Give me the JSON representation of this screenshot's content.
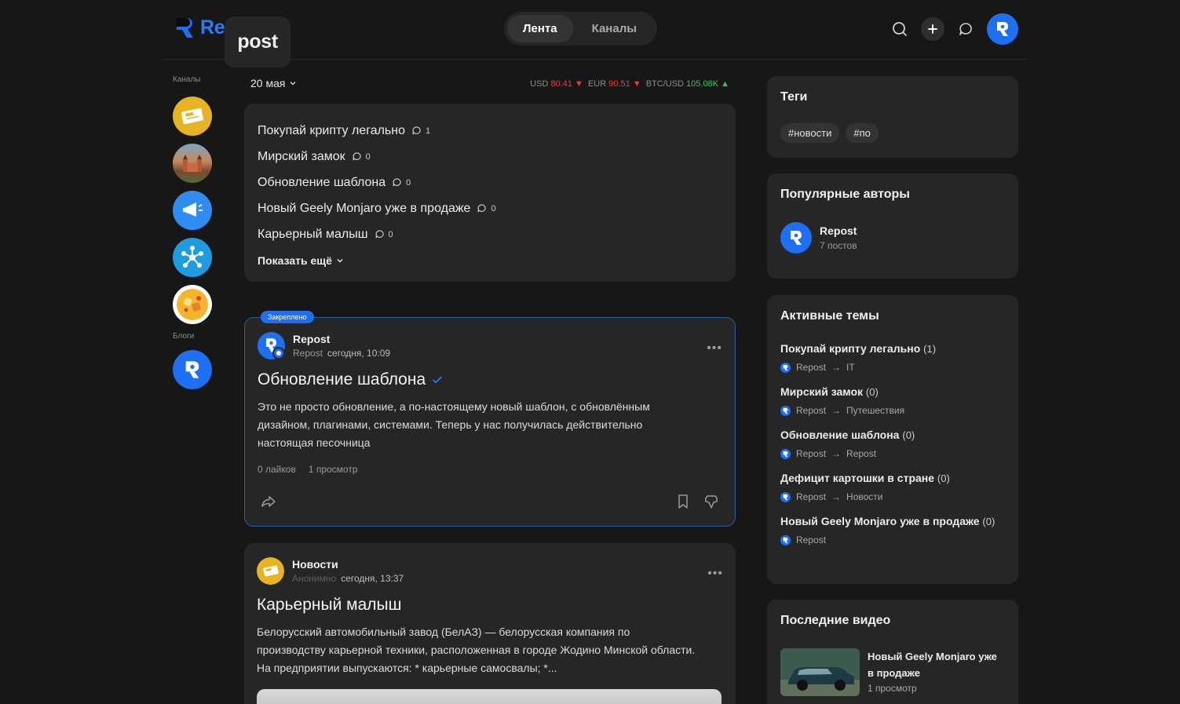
{
  "app": {
    "logo_re": "Re",
    "logo_post": "post"
  },
  "nav": {
    "tabs": [
      {
        "label": "Лента",
        "active": true
      },
      {
        "label": "Каналы",
        "active": false
      }
    ]
  },
  "header_icons": [
    "search-icon",
    "plus-icon",
    "chat-icon",
    "user-avatar"
  ],
  "leftrail": {
    "channels_label": "Каналы",
    "blogs_label": "Блоги",
    "channels": [
      {
        "name": "news-channel",
        "color": "#e6b422"
      },
      {
        "name": "castle-channel",
        "color": "#8b6a4f"
      },
      {
        "name": "megaphone-channel",
        "color": "#2f8cf0"
      },
      {
        "name": "network-channel",
        "color": "#1f9be0"
      },
      {
        "name": "food-channel",
        "color": "#f3b52b"
      }
    ],
    "blogs": [
      {
        "name": "repost-blog",
        "color": "#1f6ff2"
      }
    ]
  },
  "feed": {
    "date": "20 мая",
    "rates": [
      {
        "label": "USD",
        "value": "80.41",
        "dir": "down"
      },
      {
        "label": "EUR",
        "value": "90.51",
        "dir": "down"
      },
      {
        "label": "BTC/USD",
        "value": "105.08K",
        "dir": "up"
      }
    ],
    "topics": [
      {
        "title": "Покупай крипту легально",
        "comments": "1"
      },
      {
        "title": "Мирский замок",
        "comments": "0"
      },
      {
        "title": "Обновление шаблона",
        "comments": "0"
      },
      {
        "title": "Новый Geely Monjaro уже в продаже",
        "comments": "0"
      },
      {
        "title": "Карьерный малыш",
        "comments": "0"
      }
    ],
    "show_more": "Показать ещё"
  },
  "posts": [
    {
      "pinned_label": "Закреплено",
      "author": "Repost",
      "source": "Repost",
      "time": "сегодня, 10:09",
      "title": "Обновление шаблона",
      "body": "Это не просто обновление, а по-настоящему новый шаблон, с обновлённым дизайном, плагинами, системами. Теперь у нас получилась действительно настоящая песочница",
      "likes": "0 лайков",
      "views": "1 просмотр"
    },
    {
      "author": "Новости",
      "source": "Анонимно",
      "time": "сегодня, 13:37",
      "title": "Карьерный малыш",
      "body": "Белорусский автомобильный завод (БелАЗ) — белорусская компания по производству карьерной техники, расположенная в городе Жодино Минской области. На предприятии выпускаются: * карьерные самосвалы; *..."
    }
  ],
  "sidebar": {
    "tags_title": "Теги",
    "tags": [
      "#новости",
      "#по"
    ],
    "authors_title": "Популярные авторы",
    "authors": [
      {
        "name": "Repost",
        "posts": "7 постов"
      }
    ],
    "active_title": "Активные темы",
    "active": [
      {
        "title": "Покупай крипту легально",
        "count": "(1)",
        "author": "Repost",
        "arrow": "→",
        "channel": "IT"
      },
      {
        "title": "Мирский замок",
        "count": "(0)",
        "author": "Repost",
        "arrow": "→",
        "channel": "Путешествия"
      },
      {
        "title": "Обновление шаблона",
        "count": "(0)",
        "author": "Repost",
        "arrow": "→",
        "channel": "Repost"
      },
      {
        "title": "Дефицит картошки в стране",
        "count": "(0)",
        "author": "Repost",
        "arrow": "→",
        "channel": "Новости"
      },
      {
        "title": "Новый Geely Monjaro уже в продаже",
        "count": "(0)",
        "author": "Repost",
        "arrow": "",
        "channel": ""
      }
    ],
    "videos_title": "Последние видео",
    "videos": [
      {
        "title": "Новый Geely Monjaro уже в продаже",
        "views": "1 просмотр"
      }
    ]
  },
  "colors": {
    "accent": "#1f6ff2",
    "down": "#ec3b3b",
    "up": "#2ec95c",
    "background": "#171717",
    "card": "#262626"
  }
}
